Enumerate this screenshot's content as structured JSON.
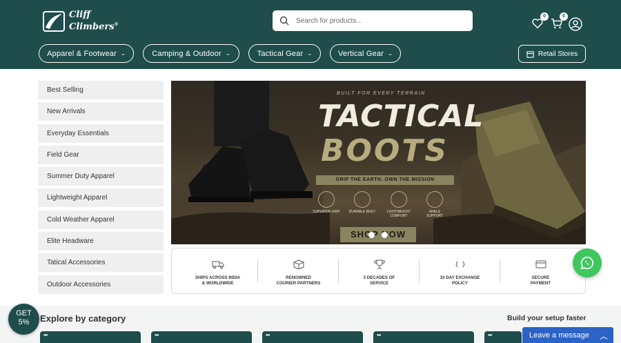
{
  "header": {
    "logo_line1": "Cliff",
    "logo_line2": "Climbers",
    "logo_mark": "®",
    "search_placeholder": "Search for products...",
    "wishlist_count": "0",
    "cart_count": "0",
    "nav": [
      {
        "label": "Apparel & Footwear"
      },
      {
        "label": "Camping & Outdoor"
      },
      {
        "label": "Tactical Gear"
      },
      {
        "label": "Vertical Gear"
      }
    ],
    "retail_label": "Retail Stores"
  },
  "sidebar": {
    "items": [
      {
        "label": "Best Selling"
      },
      {
        "label": "New Arrivals"
      },
      {
        "label": "Everyday Essentials"
      },
      {
        "label": "Field Gear"
      },
      {
        "label": "Summer Duty Apparel"
      },
      {
        "label": "Lightweight Apparel"
      },
      {
        "label": "Cold Weather Apparel"
      },
      {
        "label": "Elite Headware"
      },
      {
        "label": "Tatical Accessories"
      },
      {
        "label": "Outdoor Accessories"
      }
    ]
  },
  "banner": {
    "tagline": "BUILT FOR EVERY TERRAIN",
    "title1": "TACTICAL",
    "title2": "BOOTS",
    "strip": "GRIP THE EARTH. OWN THE MISSION",
    "features": [
      "SUPERIOR GRIP",
      "DURABLE BUILT",
      "LIGHTWEIGHT COMFORT",
      "ANKLE SUPPORT"
    ],
    "cta": "SHOP NOW"
  },
  "features_bar": [
    {
      "line1": "SHIPS ACROSS INDIA",
      "line2": "& WORLDWIDE",
      "icon": "truck-icon"
    },
    {
      "line1": "RENOWNED",
      "line2": "COURIER PARTNERS",
      "icon": "box-icon"
    },
    {
      "line1": "3 DECADES OF",
      "line2": "SERVICE",
      "icon": "trophy-icon"
    },
    {
      "line1": "10 DAY EXCHANGE",
      "line2": "POLICY",
      "icon": "exchange-icon"
    },
    {
      "line1": "SECURE",
      "line2": "PAYMENT",
      "icon": "card-icon"
    }
  ],
  "bottom": {
    "explore": "Explore by category",
    "build": "Build your setup faster",
    "get_line1": "GET",
    "get_line2": "5%",
    "leave_message": "Leave a message"
  },
  "colors": {
    "brand": "#1f4d4b",
    "whatsapp": "#3ec75d",
    "chat": "#2b63c6"
  }
}
